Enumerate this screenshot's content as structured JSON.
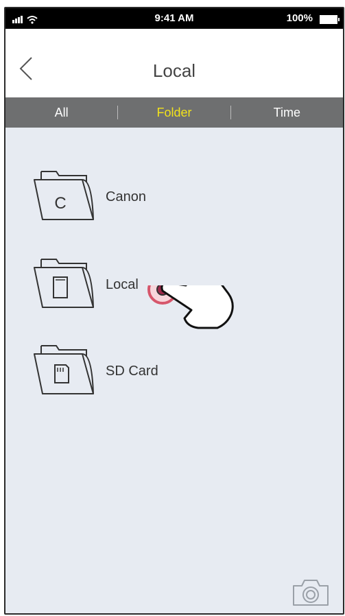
{
  "status": {
    "time": "9:41 AM",
    "battery": "100%"
  },
  "nav": {
    "title": "Local"
  },
  "tabs": [
    {
      "label": "All",
      "active": false
    },
    {
      "label": "Folder",
      "active": true
    },
    {
      "label": "Time",
      "active": false
    }
  ],
  "folders": [
    {
      "label": "Canon",
      "glyph": "C"
    },
    {
      "label": "Local"
    },
    {
      "label": "SD Card"
    }
  ],
  "colors": {
    "accent": "#f2e21c",
    "tabbar": "#6e6f70",
    "background": "#e7ebf2",
    "tap_indicator": "#d6566b"
  }
}
